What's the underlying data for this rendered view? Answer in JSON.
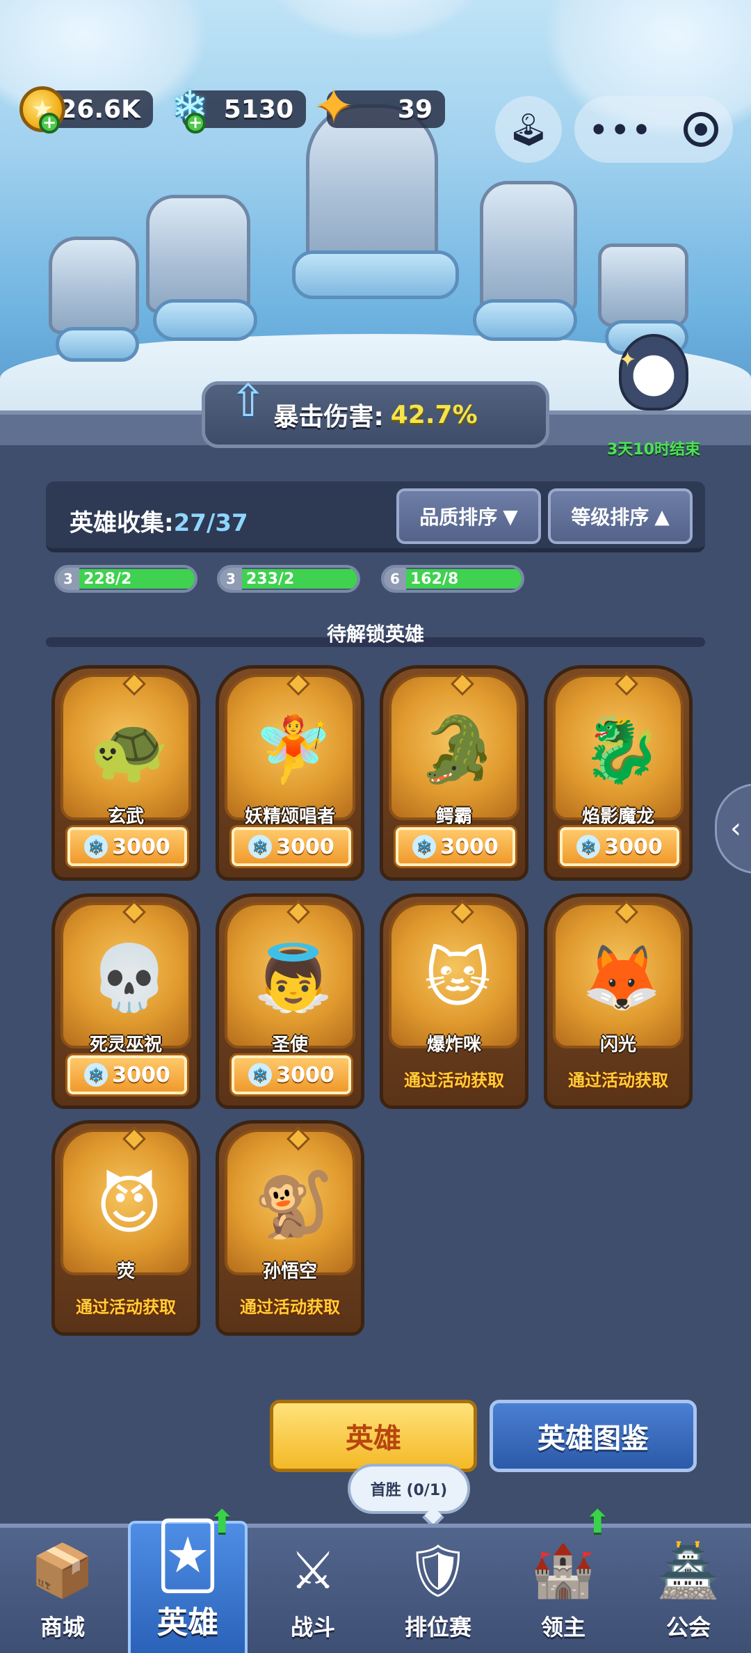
{
  "currencies": {
    "gold": "26.6K",
    "diamonds": "5130",
    "crystals": "39"
  },
  "scene": {
    "crit_label": "暴击伤害:",
    "crit_value": "42.7%",
    "event_timer": "3天10时结束"
  },
  "collection": {
    "title": "英雄收集:",
    "count": "27/37",
    "sort_quality": "品质排序",
    "sort_level": "等级排序",
    "owned_partial": [
      {
        "level": "3",
        "progress": "228/2"
      },
      {
        "level": "3",
        "progress": "233/2"
      },
      {
        "level": "6",
        "progress": "162/8"
      }
    ],
    "locked_section_title": "待解锁英雄"
  },
  "heroes": [
    {
      "name": "玄武",
      "price": "3000",
      "icon": "🐢"
    },
    {
      "name": "妖精颂唱者",
      "price": "3000",
      "icon": "🧚"
    },
    {
      "name": "鳄霸",
      "price": "3000",
      "icon": "🐊"
    },
    {
      "name": "焰影魔龙",
      "price": "3000",
      "icon": "🐉"
    },
    {
      "name": "死灵巫祝",
      "price": "3000",
      "icon": "💀"
    },
    {
      "name": "圣使",
      "price": "3000",
      "icon": "👼"
    },
    {
      "name": "爆炸咪",
      "event": "通过活动获取",
      "icon": "🐱"
    },
    {
      "name": "闪光",
      "event": "通过活动获取",
      "icon": "🦊"
    },
    {
      "name": "荧",
      "event": "通过活动获取",
      "icon": "😈"
    },
    {
      "name": "孙悟空",
      "event": "通过活动获取",
      "icon": "🐒"
    }
  ],
  "buttons": {
    "heroes": "英雄",
    "codex": "英雄图鉴",
    "tooltip": "首胜 (0/1)"
  },
  "tabs": [
    {
      "label": "商城",
      "icon": "📦"
    },
    {
      "label": "英雄",
      "icon": "🃏"
    },
    {
      "label": "战斗",
      "icon": "⚔"
    },
    {
      "label": "排位赛",
      "icon": "🛡"
    },
    {
      "label": "领主",
      "icon": "🏰"
    },
    {
      "label": "公会",
      "icon": "🏯"
    }
  ],
  "colors": {
    "accent_yellow": "#f7e34a",
    "accent_green": "#4ee05a",
    "accent_blue": "#8fd6ff",
    "event_text": "#ffcf3a"
  }
}
